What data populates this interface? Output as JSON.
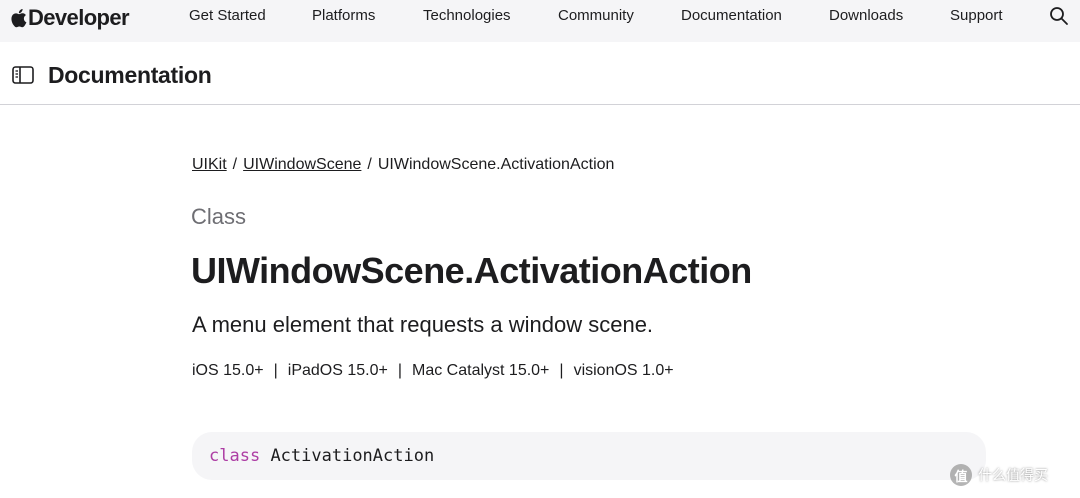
{
  "globalnav": {
    "brand": "Developer",
    "links": [
      "Get Started",
      "Platforms",
      "Technologies",
      "Community",
      "Documentation",
      "Downloads",
      "Support"
    ]
  },
  "docbar": {
    "title": "Documentation"
  },
  "breadcrumb": {
    "items": [
      "UIKit",
      "UIWindowScene",
      "UIWindowScene.ActivationAction"
    ],
    "separator": "/"
  },
  "symbol": {
    "kind": "Class",
    "title": "UIWindowScene.ActivationAction",
    "abstract": "A menu element that requests a window scene."
  },
  "availability": {
    "items": [
      "iOS 15.0+",
      "iPadOS 15.0+",
      "Mac Catalyst 15.0+",
      "visionOS 1.0+"
    ],
    "separator": "|"
  },
  "declaration": {
    "keyword": "class",
    "name": "ActivationAction"
  },
  "watermark": {
    "badge": "值",
    "text": "什么值得买"
  },
  "colors": {
    "nav_bg": "#f5f5f7",
    "text": "#1d1d1f",
    "eyebrow": "#6e6e73",
    "keyword": "#ad3da4",
    "code_bg": "#f5f5f7",
    "divider": "#d2d2d7"
  }
}
